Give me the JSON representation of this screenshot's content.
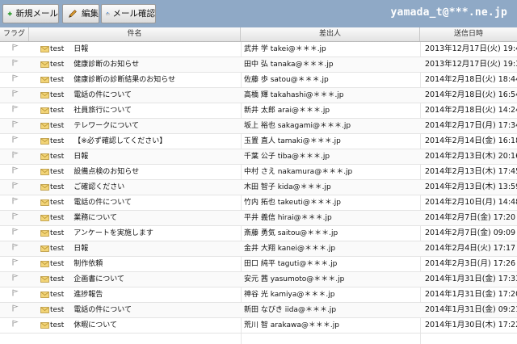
{
  "toolbar": {
    "new_mail_label": "新規メール",
    "edit_label": "編集",
    "check_mail_label": "メール確認",
    "user": "yamada_t@***.ne.jp"
  },
  "columns": {
    "flag": "フラグ",
    "subject": "件名",
    "from": "差出人",
    "date": "送信日時"
  },
  "emails": [
    {
      "tag": "test",
      "subject": "日報",
      "from": "武井 学 takei@＊＊＊.jp",
      "date": "2013年12月17日(火) 19:44"
    },
    {
      "tag": "test",
      "subject": "健康診断のお知らせ",
      "from": "田中 弘 tanaka@＊＊＊.jp",
      "date": "2013年12月17日(火) 19:35"
    },
    {
      "tag": "test",
      "subject": "健康診断の診断結果のお知らせ",
      "from": "佐藤 歩 satou@＊＊＊.jp",
      "date": "2014年2月18日(火) 18:44"
    },
    {
      "tag": "test",
      "subject": "電話の件について",
      "from": "高橋 輝 takahashi@＊＊＊.jp",
      "date": "2014年2月18日(火) 16:54"
    },
    {
      "tag": "test",
      "subject": "社員旅行について",
      "from": "新井 太郎 arai@＊＊＊.jp",
      "date": "2014年2月18日(火) 14:24"
    },
    {
      "tag": "test",
      "subject": "テレワークについて",
      "from": "坂上 裕也 sakagami@＊＊＊.jp",
      "date": "2014年2月17日(月) 17:34"
    },
    {
      "tag": "test",
      "subject": "【※必ず確認してください】",
      "from": "玉置 直人 tamaki@＊＊＊.jp",
      "date": "2014年2月14日(金) 16:18"
    },
    {
      "tag": "test",
      "subject": "日報",
      "from": "千葉 公子 tiba@＊＊＊.jp",
      "date": "2014年2月13日(木) 20:16"
    },
    {
      "tag": "test",
      "subject": "設備点検のお知らせ",
      "from": "中村 さえ nakamura@＊＊＊.jp",
      "date": "2014年2月13日(木) 17:45"
    },
    {
      "tag": "test",
      "subject": "ご確認ください",
      "from": "木田 智子 kida@＊＊＊.jp",
      "date": "2014年2月13日(木) 13:59"
    },
    {
      "tag": "test",
      "subject": "電話の件について",
      "from": "竹内 拓也 takeuti@＊＊＊.jp",
      "date": "2014年2月10日(月) 14:48"
    },
    {
      "tag": "test",
      "subject": "業務について",
      "from": "平井 義信 hirai@＊＊＊.jp",
      "date": "2014年2月7日(金) 17:20"
    },
    {
      "tag": "test",
      "subject": "アンケートを実施します",
      "from": "斎藤 勇気 saitou@＊＊＊.jp",
      "date": "2014年2月7日(金) 09:09"
    },
    {
      "tag": "test",
      "subject": "日報",
      "from": "金井 大翔 kanei@＊＊＊.jp",
      "date": "2014年2月4日(火) 17:17"
    },
    {
      "tag": "test",
      "subject": "制作依頼",
      "from": "田口 純平 taguti@＊＊＊.jp",
      "date": "2014年2月3日(月) 17:26"
    },
    {
      "tag": "test",
      "subject": "企画書について",
      "from": "安元 茜 yasumoto@＊＊＊.jp",
      "date": "2014年1月31日(金) 17:33"
    },
    {
      "tag": "test",
      "subject": "進捗報告",
      "from": "神谷 光 kamiya@＊＊＊.jp",
      "date": "2014年1月31日(金) 17:20"
    },
    {
      "tag": "test",
      "subject": "電話の件について",
      "from": "新田 なびき iida@＊＊＊.jp",
      "date": "2014年1月31日(金) 09:21"
    },
    {
      "tag": "test",
      "subject": "休暇について",
      "from": "荒川 智 arakawa@＊＊＊.jp",
      "date": "2014年1月30日(木) 17:22"
    }
  ],
  "colors": {
    "toolbar_bg": "#8fa9c6",
    "envelope": "#e8c35a"
  },
  "icons": {
    "new_mail": "plus-icon",
    "edit": "pencil-icon",
    "check_mail": "mail-download-icon",
    "flag": "flag-icon",
    "message": "envelope-icon"
  }
}
